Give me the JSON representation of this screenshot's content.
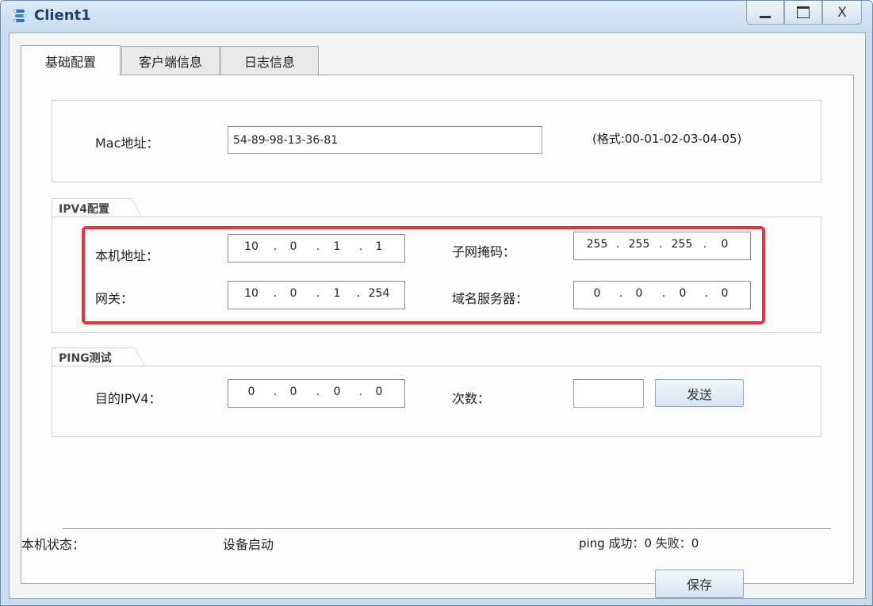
{
  "window": {
    "title": "Client1",
    "minimize_label": "",
    "maximize_label": "",
    "close_label": "X"
  },
  "tabs": [
    {
      "label": "基础配置",
      "active": true
    },
    {
      "label": "客户端信息",
      "active": false
    },
    {
      "label": "日志信息",
      "active": false
    }
  ],
  "mac": {
    "label": "Mac地址：",
    "value": "54-89-98-13-36-81",
    "hint": "(格式:00-01-02-03-04-05)"
  },
  "ipv4": {
    "group_title": "IPV4配置",
    "local_ip": {
      "label": "本机地址：",
      "octets": [
        "10",
        "0",
        "1",
        "1"
      ]
    },
    "subnet_mask": {
      "label": "子网掩码：",
      "octets": [
        "255",
        "255",
        "255",
        "0"
      ]
    },
    "gateway": {
      "label": "网关：",
      "octets": [
        "10",
        "0",
        "1",
        "254"
      ]
    },
    "dns": {
      "label": "域名服务器：",
      "octets": [
        "0",
        "0",
        "0",
        "0"
      ]
    }
  },
  "ping": {
    "group_title": "PING测试",
    "dest_label": "目的IPV4：",
    "dest_octets": [
      "0",
      "0",
      "0",
      "0"
    ],
    "count_label": "次数：",
    "count_value": "",
    "send_label": "发送"
  },
  "status": {
    "label": "本机状态：",
    "value": "设备启动",
    "ping_stats": "ping 成功：0 失败：0"
  },
  "save_label": "保存",
  "colors": {
    "highlight": "#e8343e",
    "title_text": "#1d3f6a",
    "window_frame": "#c9dcef"
  }
}
